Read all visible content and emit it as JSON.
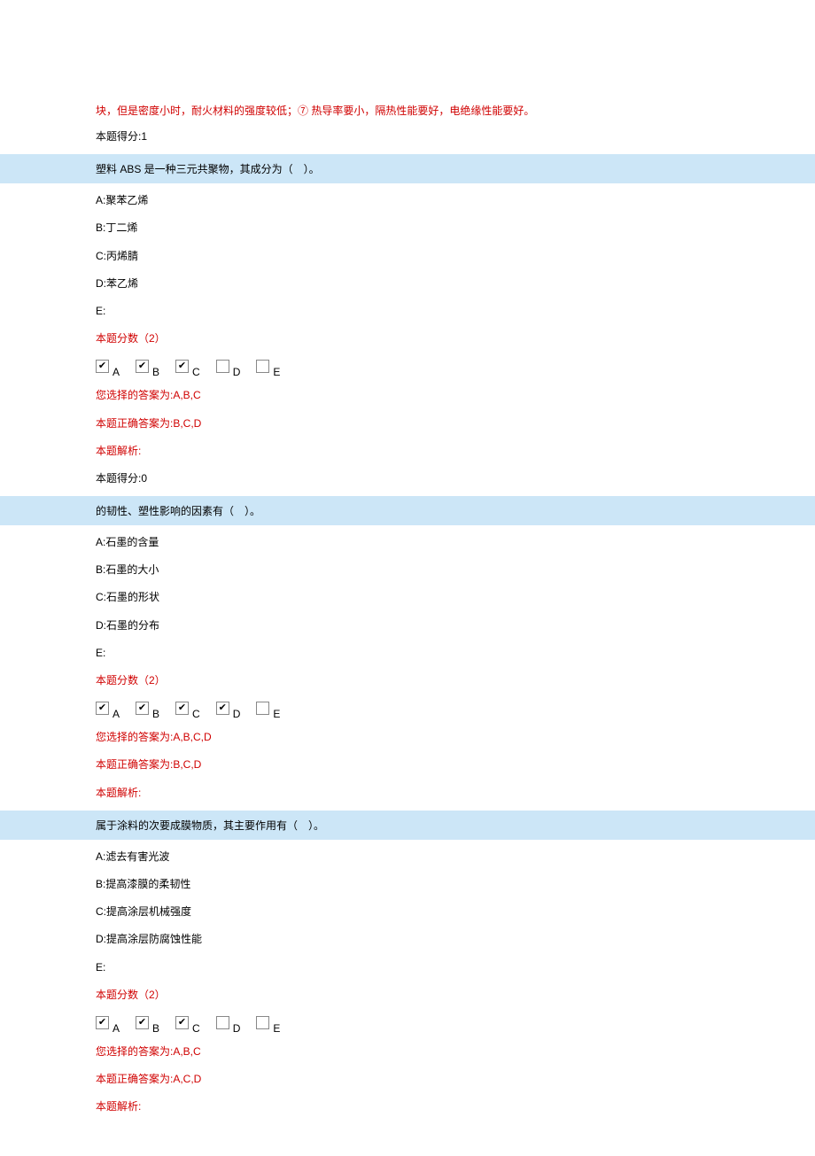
{
  "top_continuation": "块，但是密度小时，耐火材料的强度较低；⑦ 热导率要小，隔热性能要好，电绝缘性能要好。",
  "score_prev": "本题得分:1",
  "labels": {
    "A": "A",
    "B": "B",
    "C": "C",
    "D": "D",
    "E": "E"
  },
  "q1": {
    "header": "塑料 ABS 是一种三元共聚物，其成分为（　）。",
    "optA": "A:聚苯乙烯",
    "optB": "B:丁二烯",
    "optC": "C:丙烯腈",
    "optD": "D:苯乙烯",
    "optE": "E:",
    "score_label": "本题分数（2）",
    "your_answer": "您选择的答案为:A,B,C",
    "correct_answer": "本题正确答案为:B,C,D",
    "analysis": "本题解析:",
    "score_got": "本题得分:0"
  },
  "q2": {
    "header": "的韧性、塑性影响的因素有（　）。",
    "optA": "A:石墨的含量",
    "optB": "B:石墨的大小",
    "optC": "C:石墨的形状",
    "optD": "D:石墨的分布",
    "optE": "E:",
    "score_label": "本题分数（2）",
    "your_answer": "您选择的答案为:A,B,C,D",
    "correct_answer": "本题正确答案为:B,C,D",
    "analysis": "本题解析:"
  },
  "q3": {
    "header": "属于涂料的次要成膜物质，其主要作用有（　）。",
    "optA": "A:滤去有害光波",
    "optB": "B:提高漆膜的柔韧性",
    "optC": "C:提高涂层机械强度",
    "optD": "D:提高涂层防腐蚀性能",
    "optE": "E:",
    "score_label": "本题分数（2）",
    "your_answer": "您选择的答案为:A,B,C",
    "correct_answer": "本题正确答案为:A,C,D",
    "analysis": "本题解析:"
  }
}
